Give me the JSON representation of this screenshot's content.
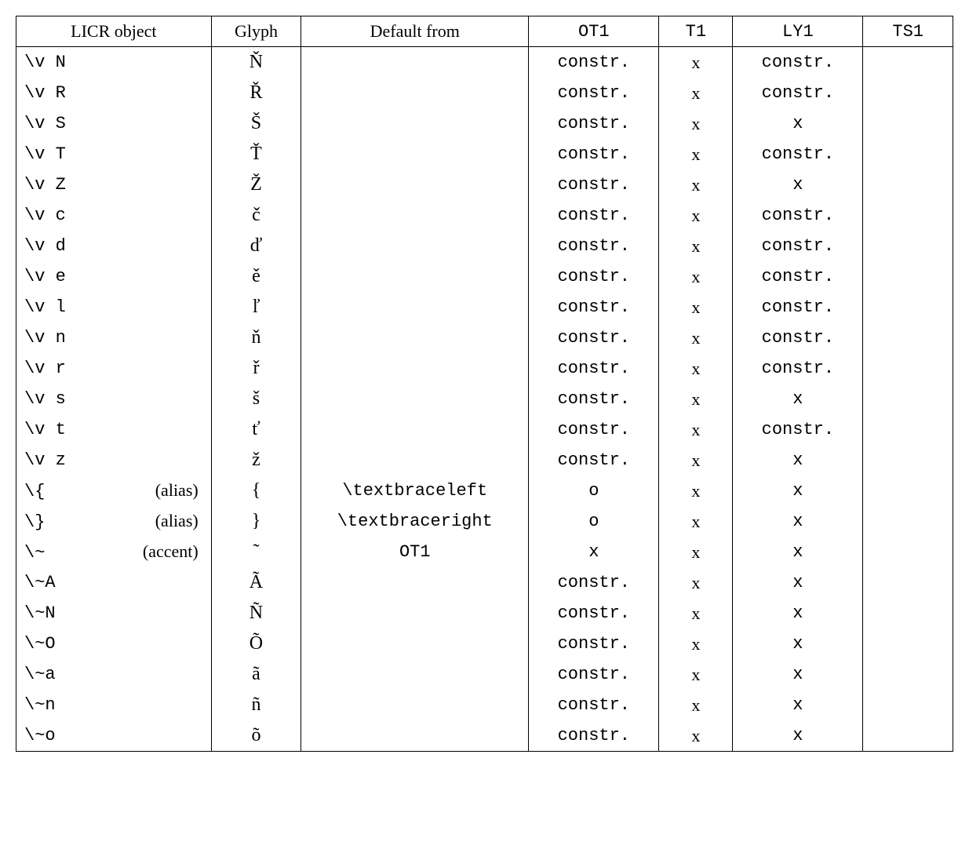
{
  "headers": {
    "licr": "LICR object",
    "glyph": "Glyph",
    "default": "Default from",
    "ot1": "OT1",
    "t1": "T1",
    "ly1": "LY1",
    "ts1": "TS1"
  },
  "rows": [
    {
      "licr": "\\v N",
      "note": "",
      "glyph": "Ň",
      "default": "",
      "ot1": "constr.",
      "t1": "x",
      "ly1": "constr.",
      "ts1": ""
    },
    {
      "licr": "\\v R",
      "note": "",
      "glyph": "Ř",
      "default": "",
      "ot1": "constr.",
      "t1": "x",
      "ly1": "constr.",
      "ts1": ""
    },
    {
      "licr": "\\v S",
      "note": "",
      "glyph": "Š",
      "default": "",
      "ot1": "constr.",
      "t1": "x",
      "ly1": "x",
      "ts1": ""
    },
    {
      "licr": "\\v T",
      "note": "",
      "glyph": "Ť",
      "default": "",
      "ot1": "constr.",
      "t1": "x",
      "ly1": "constr.",
      "ts1": ""
    },
    {
      "licr": "\\v Z",
      "note": "",
      "glyph": "Ž",
      "default": "",
      "ot1": "constr.",
      "t1": "x",
      "ly1": "x",
      "ts1": ""
    },
    {
      "licr": "\\v c",
      "note": "",
      "glyph": "č",
      "default": "",
      "ot1": "constr.",
      "t1": "x",
      "ly1": "constr.",
      "ts1": ""
    },
    {
      "licr": "\\v d",
      "note": "",
      "glyph": "ď",
      "default": "",
      "ot1": "constr.",
      "t1": "x",
      "ly1": "constr.",
      "ts1": ""
    },
    {
      "licr": "\\v e",
      "note": "",
      "glyph": "ě",
      "default": "",
      "ot1": "constr.",
      "t1": "x",
      "ly1": "constr.",
      "ts1": ""
    },
    {
      "licr": "\\v l",
      "note": "",
      "glyph": "ľ",
      "default": "",
      "ot1": "constr.",
      "t1": "x",
      "ly1": "constr.",
      "ts1": ""
    },
    {
      "licr": "\\v n",
      "note": "",
      "glyph": "ň",
      "default": "",
      "ot1": "constr.",
      "t1": "x",
      "ly1": "constr.",
      "ts1": ""
    },
    {
      "licr": "\\v r",
      "note": "",
      "glyph": "ř",
      "default": "",
      "ot1": "constr.",
      "t1": "x",
      "ly1": "constr.",
      "ts1": ""
    },
    {
      "licr": "\\v s",
      "note": "",
      "glyph": "š",
      "default": "",
      "ot1": "constr.",
      "t1": "x",
      "ly1": "x",
      "ts1": ""
    },
    {
      "licr": "\\v t",
      "note": "",
      "glyph": "ť",
      "default": "",
      "ot1": "constr.",
      "t1": "x",
      "ly1": "constr.",
      "ts1": ""
    },
    {
      "licr": "\\v z",
      "note": "",
      "glyph": "ž",
      "default": "",
      "ot1": "constr.",
      "t1": "x",
      "ly1": "x",
      "ts1": ""
    },
    {
      "licr": "\\{",
      "note": "(alias)",
      "glyph": "{",
      "default": "\\textbraceleft",
      "default_mono": true,
      "ot1": "o",
      "t1": "x",
      "ly1": "x",
      "ts1": ""
    },
    {
      "licr": "\\}",
      "note": "(alias)",
      "glyph": "}",
      "default": "\\textbraceright",
      "default_mono": true,
      "ot1": "o",
      "t1": "x",
      "ly1": "x",
      "ts1": ""
    },
    {
      "licr": "\\~",
      "note": "(accent)",
      "glyph": "˜",
      "default": "OT1",
      "default_mono": true,
      "ot1": "x",
      "t1": "x",
      "ly1": "x",
      "ts1": ""
    },
    {
      "licr": "\\~A",
      "note": "",
      "glyph": "Ã",
      "default": "",
      "ot1": "constr.",
      "t1": "x",
      "ly1": "x",
      "ts1": ""
    },
    {
      "licr": "\\~N",
      "note": "",
      "glyph": "Ñ",
      "default": "",
      "ot1": "constr.",
      "t1": "x",
      "ly1": "x",
      "ts1": ""
    },
    {
      "licr": "\\~O",
      "note": "",
      "glyph": "Õ",
      "default": "",
      "ot1": "constr.",
      "t1": "x",
      "ly1": "x",
      "ts1": ""
    },
    {
      "licr": "\\~a",
      "note": "",
      "glyph": "ã",
      "default": "",
      "ot1": "constr.",
      "t1": "x",
      "ly1": "x",
      "ts1": ""
    },
    {
      "licr": "\\~n",
      "note": "",
      "glyph": "ñ",
      "default": "",
      "ot1": "constr.",
      "t1": "x",
      "ly1": "x",
      "ts1": ""
    },
    {
      "licr": "\\~o",
      "note": "",
      "glyph": "õ",
      "default": "",
      "ot1": "constr.",
      "t1": "x",
      "ly1": "x",
      "ts1": ""
    }
  ]
}
